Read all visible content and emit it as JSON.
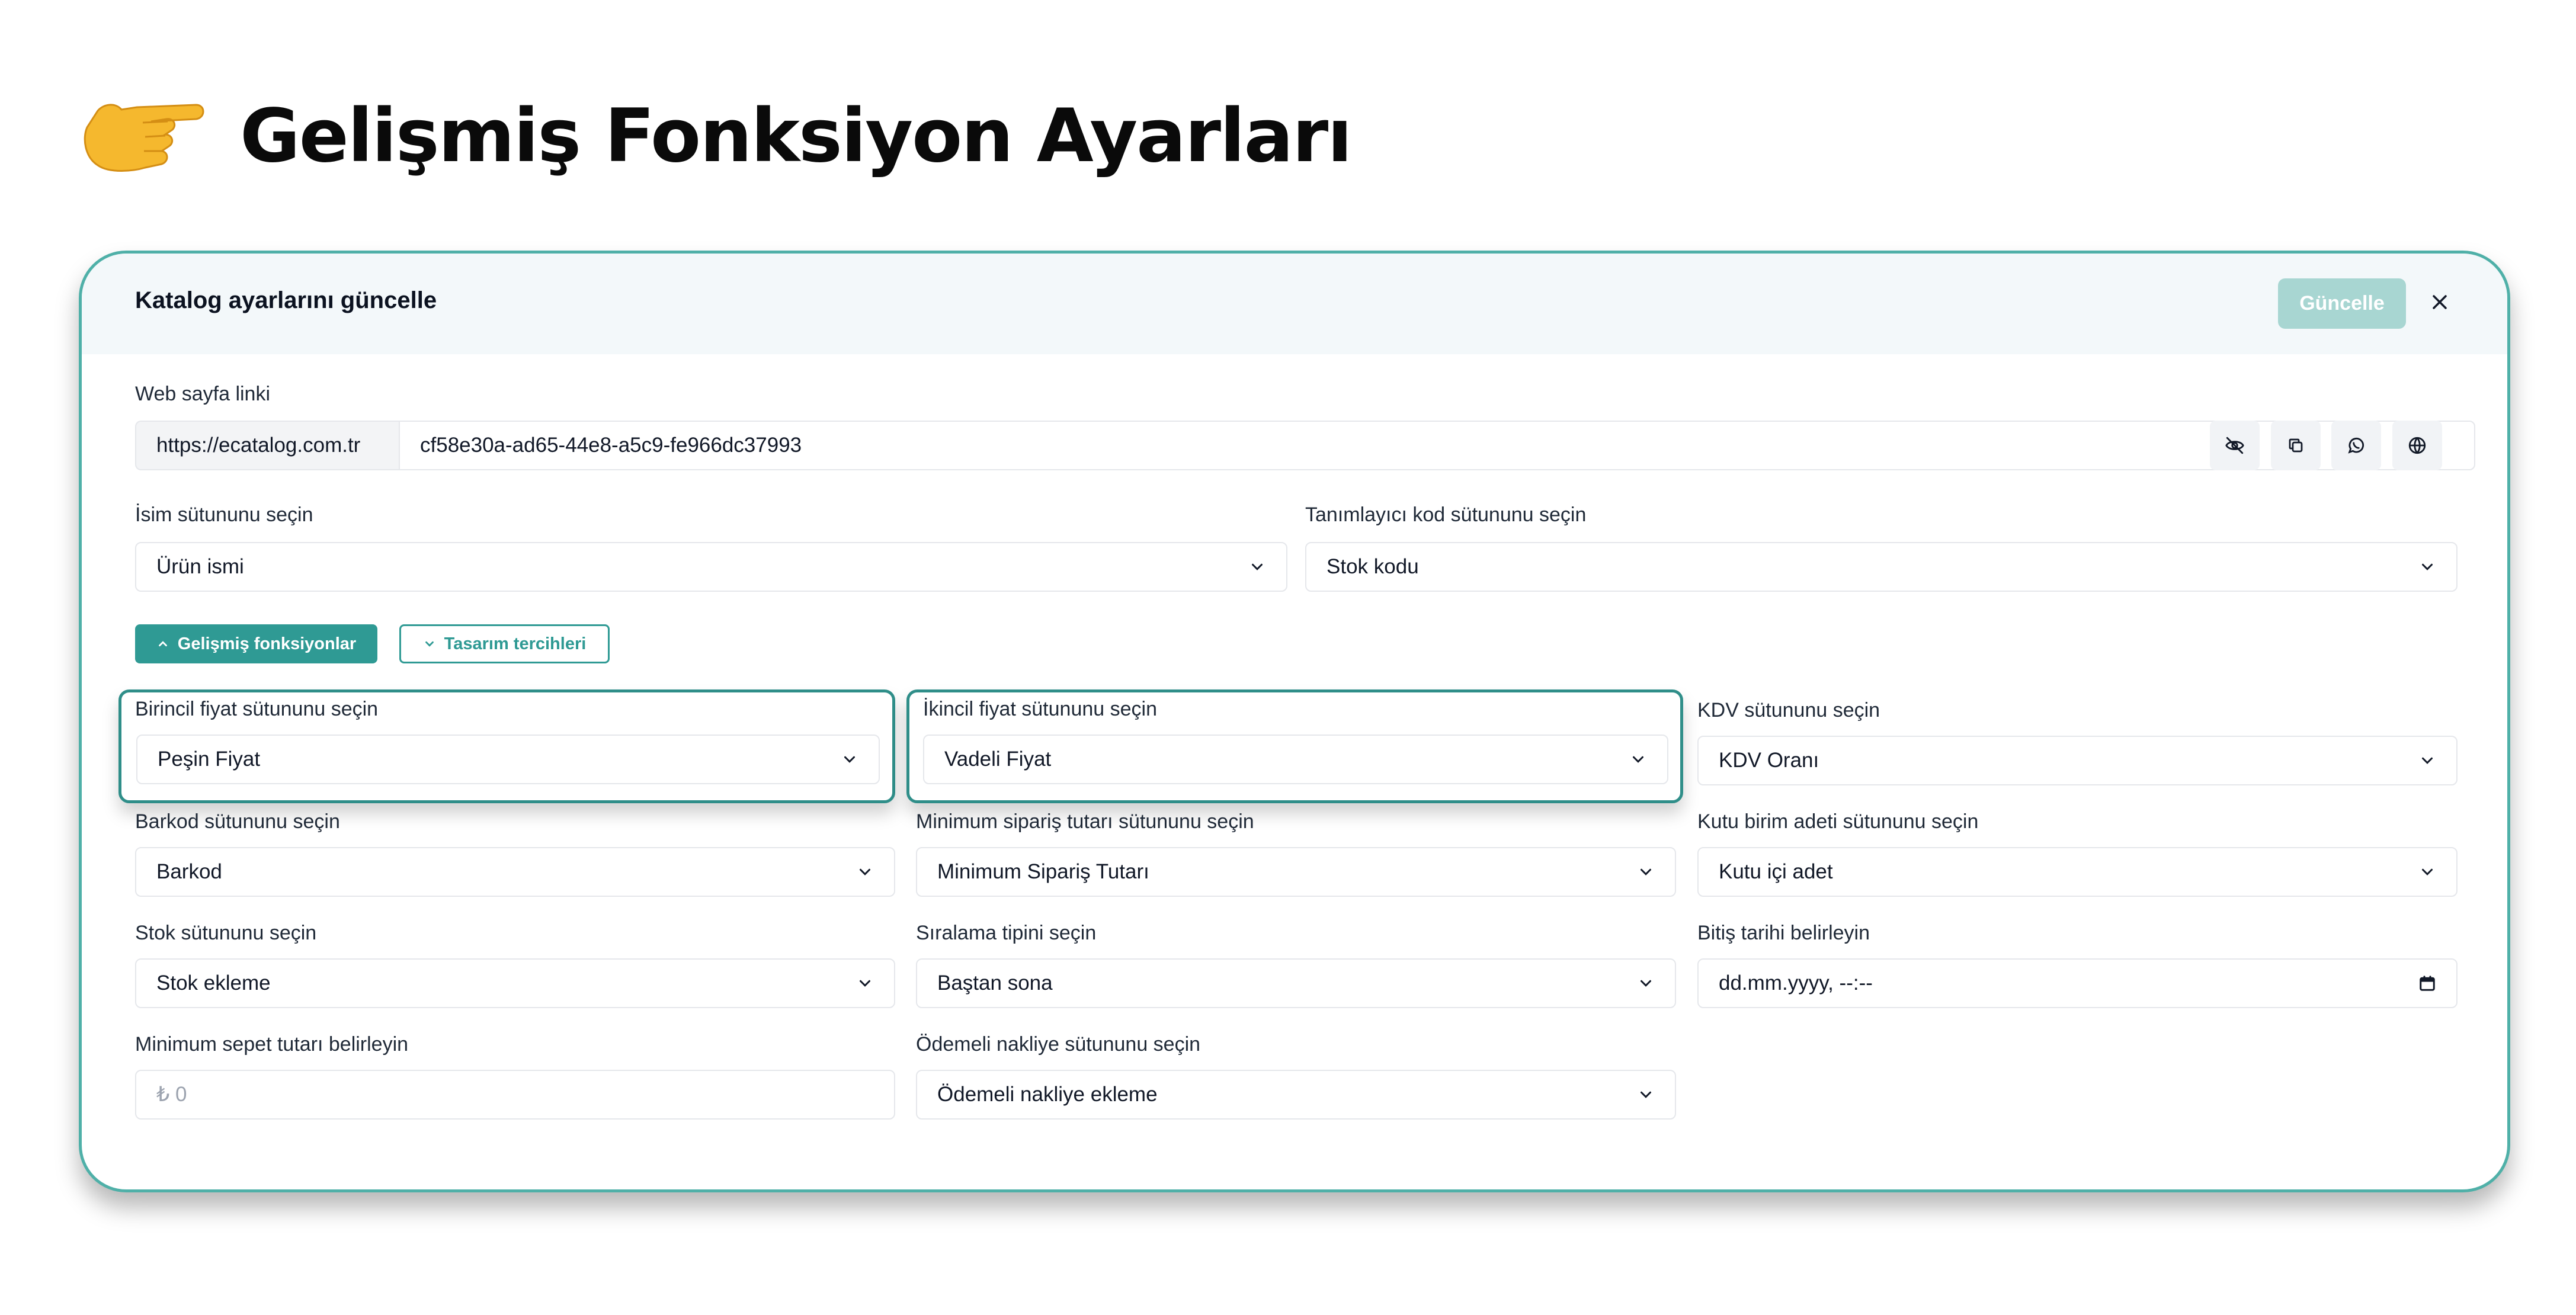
{
  "page": {
    "title": "Gelişmiş Fonksiyon Ayarları",
    "hero_icon": "pointing-hand-icon"
  },
  "dialog": {
    "title": "Katalog ayarlarını güncelle",
    "update_button": "Güncelle",
    "close_icon": "close-icon"
  },
  "web_link": {
    "label": "Web sayfa linki",
    "prefix": "https://ecatalog.com.tr",
    "value": "cf58e30a-ad65-44e8-a5c9-fe966dc37993",
    "actions": [
      "eye-off-icon",
      "copy-icon",
      "whatsapp-icon",
      "globe-icon"
    ]
  },
  "name_column": {
    "label": "İsim sütununu seçin",
    "value": "Ürün ismi"
  },
  "code_column": {
    "label": "Tanımlayıcı kod sütununu seçin",
    "value": "Stok kodu"
  },
  "tabs": {
    "advanced": "Gelişmiş fonksiyonlar",
    "design": "Tasarım tercihleri"
  },
  "fields": {
    "primary_price": {
      "label": "Birincil fiyat sütununu seçin",
      "value": "Peşin Fiyat"
    },
    "secondary_price": {
      "label": "İkincil fiyat sütununu seçin",
      "value": "Vadeli Fiyat"
    },
    "vat": {
      "label": "KDV sütununu seçin",
      "value": "KDV Oranı"
    },
    "barcode": {
      "label": "Barkod sütununu seçin",
      "value": "Barkod"
    },
    "min_order": {
      "label": "Minimum sipariş tutarı sütununu seçin",
      "value": "Minimum Sipariş Tutarı"
    },
    "box_unit": {
      "label": "Kutu birim adeti sütununu seçin",
      "value": "Kutu içi adet"
    },
    "stock": {
      "label": "Stok sütununu seçin",
      "value": "Stok ekleme"
    },
    "sort": {
      "label": "Sıralama tipini seçin",
      "value": "Baştan sona"
    },
    "end_date": {
      "label": "Bitiş tarihi belirleyin",
      "value": "dd.mm.yyyy, --:--"
    },
    "min_cart": {
      "label": "Minimum sepet tutarı belirleyin",
      "placeholder": "₺ 0"
    },
    "shipping": {
      "label": "Ödemeli nakliye sütununu seçin",
      "value": "Ödemeli nakliye ekleme"
    }
  },
  "colors": {
    "accent": "#2f9a94",
    "border": "#4fb0a8",
    "update_disabled": "#a8d6d2",
    "header_bg": "#f3f8fa"
  }
}
